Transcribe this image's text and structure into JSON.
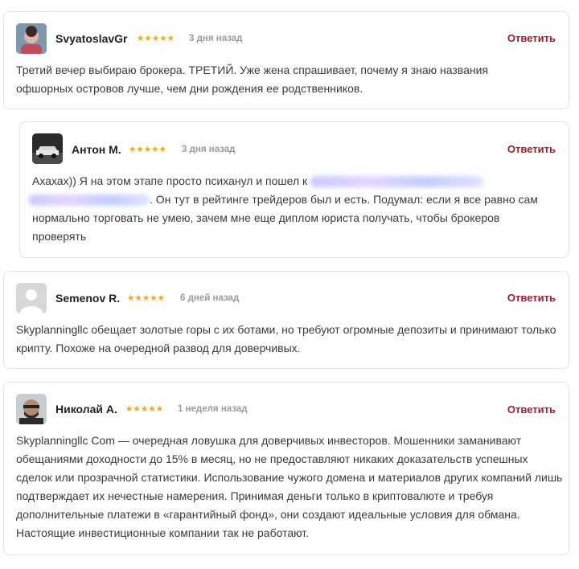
{
  "colors": {
    "accent": "#9c1d2f",
    "star": "#f3a712",
    "border": "#e3e3e8"
  },
  "reviews": [
    {
      "name": "SvyatoslavGr",
      "stars": "★★★★★",
      "date": "3 дня назад",
      "reply": "Ответить",
      "text": "Третий вечер выбираю брокера. ТРЕТИЙ. Уже жена спрашивает, почему я знаю названия офшорных островов лучше, чем дни рождения ее родственников."
    },
    {
      "name": "Антон М.",
      "stars": "★★★★★",
      "date": "3 дня назад",
      "reply": "Ответить",
      "text_a": "Ахахах)) Я на этом этапе просто психанул и пошел к",
      "text_b": ". Он тут в рейтинге трейдеров был и есть. Подумал: если я все равно сам нормально торговать не умею, зачем мне еще диплом юриста получать, чтобы брокеров проверять"
    },
    {
      "name": "Semenov R.",
      "stars": "★★★★★",
      "date": "6 дней назад",
      "reply": "Ответить",
      "text": "Skyplanningllc обещает золотые горы с их ботами, но требуют огромные депозиты и принимают только крипту. Похоже на очередной развод для доверчивых."
    },
    {
      "name": "Николай А.",
      "stars": "★★★★★",
      "date": "1 неделя назад",
      "reply": "Ответить",
      "text": "Skyplanningllc Com — очередная ловушка для доверчивых инвесторов. Мошенники заманивают обещаниями доходности до 15% в месяц, но не предоставляют никаких доказательств успешных сделок или прозрачной статистики. Использование чужого домена и материалов других компаний лишь подтверждает их нечестные намерения. Принимая деньги только в криптовалюте и требуя дополнительные платежи в «гарантийный фонд», они создают идеальные условия для обмана. Настоящие инвестиционные компании так не работают."
    }
  ]
}
